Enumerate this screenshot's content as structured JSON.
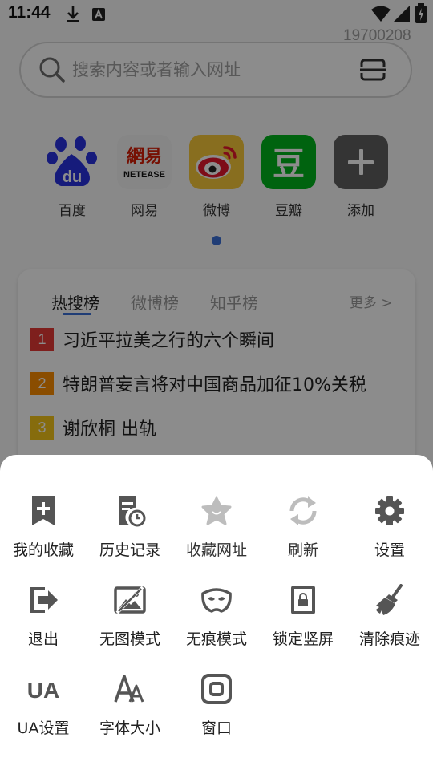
{
  "status_bar": {
    "time": "11:44"
  },
  "stamp": "19700208",
  "search": {
    "placeholder": "搜索内容或者输入网址"
  },
  "shortcuts": [
    {
      "label": "百度",
      "icon": "baidu-logo"
    },
    {
      "label": "网易",
      "icon": "netease-logo",
      "logo_text": "網易",
      "logo_sub": "NETEASE"
    },
    {
      "label": "微博",
      "icon": "weibo-logo"
    },
    {
      "label": "豆瓣",
      "icon": "douban-logo",
      "logo_text": "豆"
    },
    {
      "label": "添加",
      "icon": "plus-icon"
    }
  ],
  "hot": {
    "tabs": [
      "热搜榜",
      "微博榜",
      "知乎榜"
    ],
    "more": "更多 >",
    "items": [
      {
        "rank": "1",
        "title": "习近平拉美之行的六个瞬间",
        "color": "#e53935"
      },
      {
        "rank": "2",
        "title": "特朗普妄言将对中国商品加征10%关税",
        "color": "#fb8c00"
      },
      {
        "rank": "3",
        "title": "谢欣桐 出轨",
        "color": "#f5c518"
      }
    ]
  },
  "menu": {
    "items": [
      {
        "label": "我的收藏",
        "icon": "bookmark-add-icon"
      },
      {
        "label": "历史记录",
        "icon": "history-icon"
      },
      {
        "label": "收藏网址",
        "icon": "star-icon"
      },
      {
        "label": "刷新",
        "icon": "refresh-icon"
      },
      {
        "label": "设置",
        "icon": "gear-icon"
      },
      {
        "label": "退出",
        "icon": "exit-icon"
      },
      {
        "label": "无图模式",
        "icon": "no-image-icon"
      },
      {
        "label": "无痕模式",
        "icon": "mask-icon"
      },
      {
        "label": "锁定竖屏",
        "icon": "lock-portrait-icon"
      },
      {
        "label": "清除痕迹",
        "icon": "broom-icon"
      },
      {
        "label": "UA设置",
        "icon": "ua-icon",
        "icon_text": "UA"
      },
      {
        "label": "字体大小",
        "icon": "font-size-icon"
      },
      {
        "label": "窗口",
        "icon": "window-icon"
      }
    ]
  },
  "colors": {
    "accent": "#3b6fd8",
    "icon_dark": "#555555",
    "icon_disabled": "#bdbdbd"
  }
}
